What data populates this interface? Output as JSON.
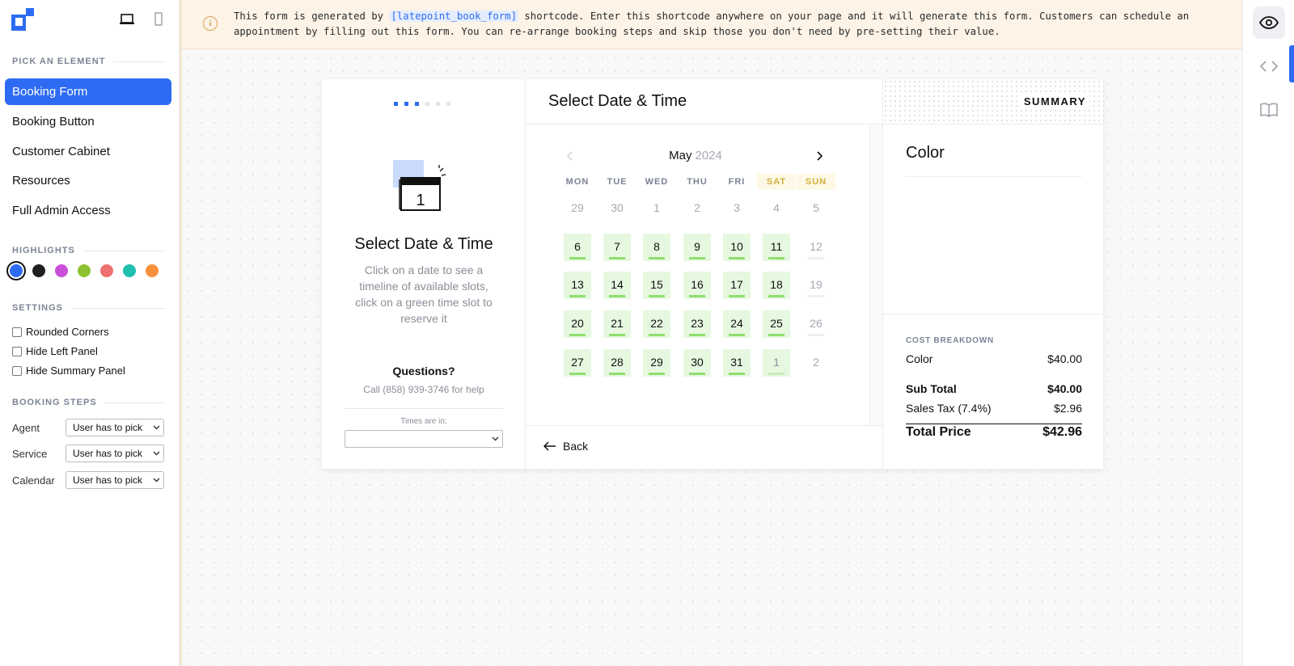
{
  "left_panel": {
    "pick_label": "PICK AN ELEMENT",
    "elements": [
      "Booking Form",
      "Booking Button",
      "Customer Cabinet",
      "Resources",
      "Full Admin Access"
    ],
    "highlights_label": "HIGHLIGHTS",
    "highlight_colors": [
      "#2d6cf2",
      "#1f1f1f",
      "#c94fd8",
      "#8ec232",
      "#f07171",
      "#1fbfb0",
      "#f7913b"
    ],
    "settings_label": "SETTINGS",
    "settings": [
      "Rounded Corners",
      "Hide Left Panel",
      "Hide Summary Panel"
    ],
    "steps_label": "BOOKING STEPS",
    "steps": [
      {
        "label": "Agent",
        "value": "User has to pick"
      },
      {
        "label": "Service",
        "value": "User has to pick"
      },
      {
        "label": "Calendar",
        "value": "User has to pick"
      }
    ]
  },
  "notice": {
    "before": "This form is generated by ",
    "code": "[latepoint_book_form]",
    "after": " shortcode. Enter this shortcode anywhere on your page and it will generate this form. Customers can schedule an appointment by filling out this form. You can re-arrange booking steps and skip those you don't need by pre-setting their value."
  },
  "side": {
    "title": "Select Date & Time",
    "description": "Click on a date to see a timeline of available slots, click on a green time slot to reserve it",
    "questions_title": "Questions?",
    "questions_text": "Call (858) 939-3746 for help",
    "timezone_label": "Times are in:",
    "calendar_day": "1"
  },
  "calendar": {
    "header": "Select Date & Time",
    "month": "May",
    "year": "2024",
    "weekdays": [
      "MON",
      "TUE",
      "WED",
      "THU",
      "FRI",
      "SAT",
      "SUN"
    ],
    "weeks": [
      [
        [
          "29",
          "none"
        ],
        [
          "30",
          "none"
        ],
        [
          "1",
          "none"
        ],
        [
          "2",
          "none"
        ],
        [
          "3",
          "none"
        ],
        [
          "4",
          "none"
        ],
        [
          "5",
          "none"
        ]
      ],
      [
        [
          "6",
          "avail"
        ],
        [
          "7",
          "avail"
        ],
        [
          "8",
          "avail"
        ],
        [
          "9",
          "avail"
        ],
        [
          "10",
          "avail"
        ],
        [
          "11",
          "avail"
        ],
        [
          "12",
          "off"
        ]
      ],
      [
        [
          "13",
          "avail"
        ],
        [
          "14",
          "avail"
        ],
        [
          "15",
          "avail"
        ],
        [
          "16",
          "avail"
        ],
        [
          "17",
          "avail"
        ],
        [
          "18",
          "avail"
        ],
        [
          "19",
          "off"
        ]
      ],
      [
        [
          "20",
          "avail"
        ],
        [
          "21",
          "avail"
        ],
        [
          "22",
          "avail"
        ],
        [
          "23",
          "avail"
        ],
        [
          "24",
          "avail"
        ],
        [
          "25",
          "avail"
        ],
        [
          "26",
          "off"
        ]
      ],
      [
        [
          "27",
          "avail"
        ],
        [
          "28",
          "avail"
        ],
        [
          "29",
          "avail"
        ],
        [
          "30",
          "avail"
        ],
        [
          "31",
          "avail"
        ],
        [
          "1",
          "next"
        ],
        [
          "2",
          "none"
        ]
      ]
    ],
    "back_label": "Back"
  },
  "summary": {
    "label": "SUMMARY",
    "service": "Color",
    "breakdown_title": "COST BREAKDOWN",
    "line_item": {
      "label": "Color",
      "value": "$40.00"
    },
    "subtotal": {
      "label": "Sub Total",
      "value": "$40.00"
    },
    "tax": {
      "label": "Sales Tax (7.4%)",
      "value": "$2.96"
    },
    "total": {
      "label": "Total Price",
      "value": "$42.96"
    }
  }
}
